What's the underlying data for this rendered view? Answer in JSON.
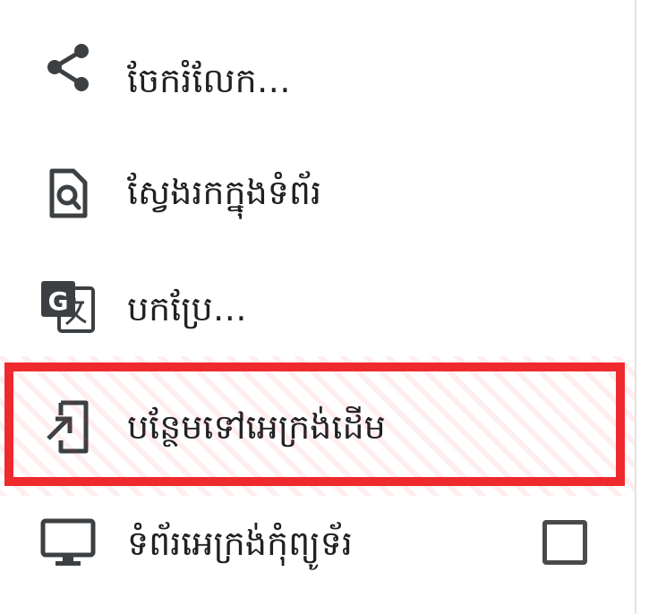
{
  "menu": {
    "items": [
      {
        "label": "ចែករំលែក…",
        "icon": "share-icon"
      },
      {
        "label": "ស្វែងរកក្នុងទំព័រ",
        "icon": "find-in-page-icon"
      },
      {
        "label": "បកប្រែ…",
        "icon": "translate-icon"
      },
      {
        "label": "បន្ថែមទៅអេក្រង់ដើម",
        "icon": "add-to-home-screen-icon",
        "highlighted": true
      },
      {
        "label": "ទំព័រអេក្រង់កុំព្យូទ័រ",
        "icon": "desktop-icon",
        "checkbox": {
          "checked": false
        }
      }
    ]
  },
  "colors": {
    "highlight_border": "#ee2a2e",
    "icon": "#3c4043",
    "text": "#202124"
  }
}
